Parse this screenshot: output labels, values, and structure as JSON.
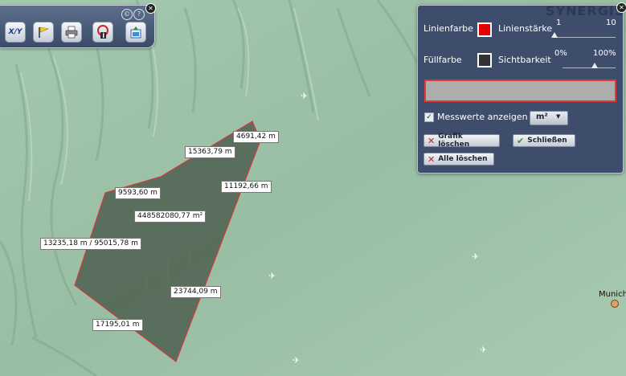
{
  "map": {
    "polygon_labels": [
      {
        "id": "seg-top",
        "text": "4691,42 m"
      },
      {
        "id": "seg-upper-left",
        "text": "15363,79 m"
      },
      {
        "id": "seg-right-upper",
        "text": "11192,66 m"
      },
      {
        "id": "seg-left-upper",
        "text": "9593,60 m"
      },
      {
        "id": "area",
        "text": "448582080,77 m²"
      },
      {
        "id": "seg-left",
        "text": "13235,18 m / 95015,78 m"
      },
      {
        "id": "seg-right-lower",
        "text": "23744,09 m"
      },
      {
        "id": "seg-bottom",
        "text": "17195,01 m"
      }
    ],
    "city": "Munich",
    "polygon_colors": {
      "stroke": "#d63a3a",
      "fill": "#4e5f4f"
    }
  },
  "toolbar": {
    "small_buttons": [
      "©",
      "?"
    ],
    "buttons": [
      {
        "name": "xy-coordinates-button",
        "icon": "xy-icon",
        "text": "X/Y"
      },
      {
        "name": "flag-button",
        "icon": "flag-icon",
        "text": ""
      },
      {
        "name": "print-button",
        "icon": "print-icon",
        "text": ""
      },
      {
        "name": "info-button",
        "icon": "info-icon",
        "text": ""
      },
      {
        "name": "export-button",
        "icon": "export-icon",
        "text": ""
      }
    ]
  },
  "panel": {
    "brand": "SYNERGIS",
    "line_color_label": "Linienfarbe",
    "line_width_label": "Linienstärke",
    "line_width_min": "1",
    "line_width_max": "10",
    "fill_color_label": "Füllfarbe",
    "visibility_label": "Sichtbarkeit",
    "visibility_min": "0%",
    "visibility_max": "100%",
    "line_color": "#e60000",
    "fill_color": "#333333",
    "show_measurements_label": "Messwerte anzeigen",
    "show_measurements_checked": true,
    "checkmark": "✓",
    "unit_selected": "m²",
    "unit_arrow": "▼",
    "clear_graphic_label": "Grafik löschen",
    "close_label": "Schließen",
    "clear_all_label": "Alle löschen",
    "line_width_level": 0.0,
    "visibility_level": 0.6
  }
}
